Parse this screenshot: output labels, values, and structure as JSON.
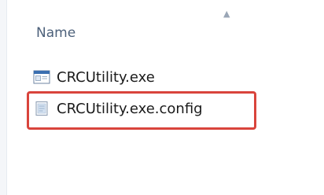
{
  "header": {
    "column_label": "Name",
    "sort_indicator": "▲"
  },
  "files": [
    {
      "name": "CRCUtility.exe",
      "icon": "application-exe-icon"
    },
    {
      "name": "CRCUtility.exe.config",
      "icon": "config-file-icon"
    }
  ],
  "annotation": {
    "highlight_color": "#d9443c"
  }
}
